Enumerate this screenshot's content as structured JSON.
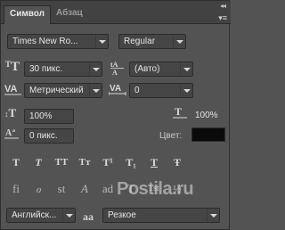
{
  "tabs": {
    "active": "Символ",
    "inactive": "Абзац"
  },
  "header": {
    "collapse_glyph": "◂◂",
    "menu_glyph": "▾≡"
  },
  "font": {
    "family": "Times New Ro...",
    "style": "Regular"
  },
  "size": {
    "font_size": "30 пикс.",
    "leading": "(Авто)"
  },
  "spacing": {
    "kerning": "Метрический",
    "tracking": "0"
  },
  "scale": {
    "vertical": "100%",
    "horizontal": "100%"
  },
  "baseline": {
    "shift": "0 пикс.",
    "color_label": "Цвет:",
    "color": "#0a0a0a"
  },
  "type_buttons": [
    "T",
    "T",
    "TT",
    "Tт",
    "T¹",
    "T₁",
    "T",
    "Ŧ"
  ],
  "opentype_buttons": [
    "fi",
    "ℴ",
    "st",
    "A",
    "ad",
    "T",
    "1st",
    "½"
  ],
  "footer": {
    "language": "Английск...",
    "aa_label": "aa",
    "antialias": "Резкое"
  },
  "watermark": "Postila.ru"
}
